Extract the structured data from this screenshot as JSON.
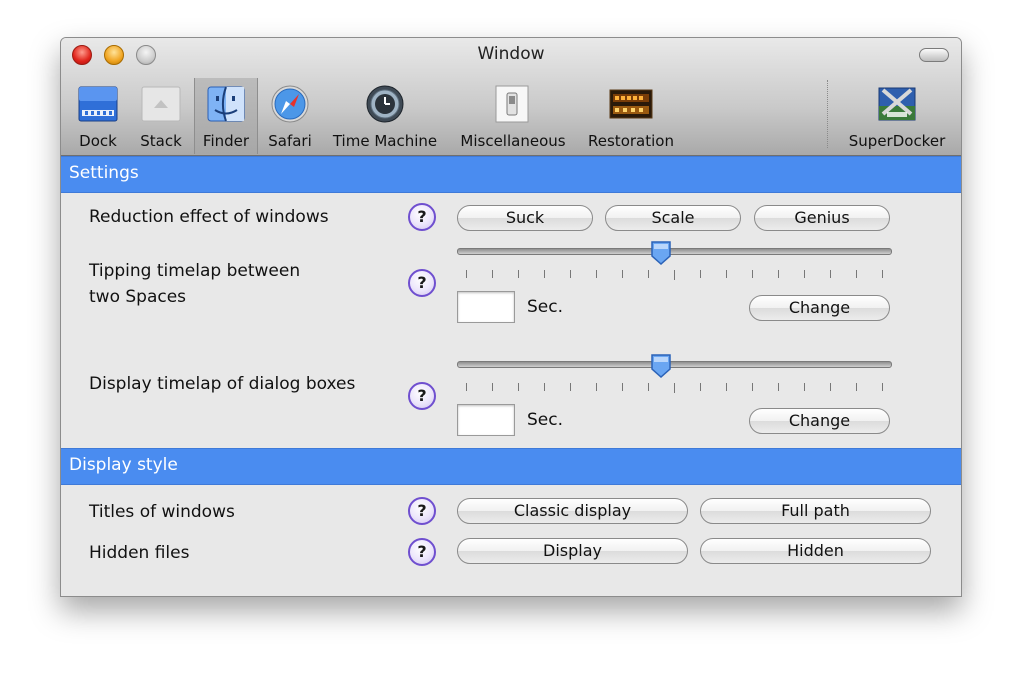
{
  "window": {
    "title": "Window"
  },
  "toolbar": {
    "items": [
      {
        "label": "Dock",
        "icon": "dock-icon"
      },
      {
        "label": "Stack",
        "icon": "stack-icon"
      },
      {
        "label": "Finder",
        "icon": "finder-icon",
        "selected": true
      },
      {
        "label": "Safari",
        "icon": "safari-icon"
      },
      {
        "label": "Time Machine",
        "icon": "time-machine-icon"
      },
      {
        "label": "Miscellaneous",
        "icon": "switch-icon"
      },
      {
        "label": "Restoration",
        "icon": "warning-display-icon"
      },
      {
        "label": "SuperDocker",
        "icon": "superdocker-icon"
      }
    ]
  },
  "settings": {
    "header": "Settings",
    "reduction": {
      "label": "Reduction effect of windows",
      "buttons": [
        "Suck",
        "Scale",
        "Genius"
      ]
    },
    "tipping": {
      "label_line1": "Tipping timelap between",
      "label_line2": "two Spaces",
      "slider_value": 0.47,
      "field_value": "",
      "unit": "Sec.",
      "button": "Change"
    },
    "dialog": {
      "label": "Display timelap of dialog boxes",
      "slider_value": 0.47,
      "field_value": "",
      "unit": "Sec.",
      "button": "Change"
    }
  },
  "display_style": {
    "header": "Display style",
    "titles": {
      "label": "Titles of windows",
      "buttons": [
        "Classic display",
        "Full path"
      ]
    },
    "hidden": {
      "label": "Hidden files",
      "buttons": [
        "Display",
        "Hidden"
      ]
    }
  },
  "help_glyph": "?",
  "colors": {
    "section_header": "#4a8cf0",
    "help_border": "#6f4fcf"
  }
}
